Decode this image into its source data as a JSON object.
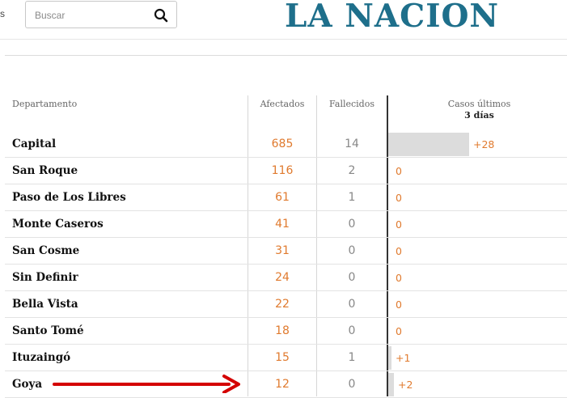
{
  "header": {
    "left_fragment": "s",
    "search": {
      "placeholder": "Buscar"
    },
    "logo": "LA NACION"
  },
  "table": {
    "headers": {
      "department": "Departamento",
      "affected": "Afectados",
      "deceased": "Fallecidos",
      "recent_cases_line1": "Casos últimos",
      "recent_cases_line2": "3 días"
    },
    "rows": [
      {
        "name": "Capital",
        "affected": "685",
        "deceased": "14",
        "recent": "+28",
        "recent_value": 28
      },
      {
        "name": "San Roque",
        "affected": "116",
        "deceased": "2",
        "recent": "0",
        "recent_value": 0
      },
      {
        "name": "Paso de Los Libres",
        "affected": "61",
        "deceased": "1",
        "recent": "0",
        "recent_value": 0
      },
      {
        "name": "Monte Caseros",
        "affected": "41",
        "deceased": "0",
        "recent": "0",
        "recent_value": 0
      },
      {
        "name": "San Cosme",
        "affected": "31",
        "deceased": "0",
        "recent": "0",
        "recent_value": 0
      },
      {
        "name": "Sin Definir",
        "affected": "24",
        "deceased": "0",
        "recent": "0",
        "recent_value": 0
      },
      {
        "name": "Bella Vista",
        "affected": "22",
        "deceased": "0",
        "recent": "0",
        "recent_value": 0
      },
      {
        "name": "Santo Tomé",
        "affected": "18",
        "deceased": "0",
        "recent": "0",
        "recent_value": 0
      },
      {
        "name": "Ituzaingó",
        "affected": "15",
        "deceased": "1",
        "recent": "+1",
        "recent_value": 1
      },
      {
        "name": "Goya",
        "affected": "12",
        "deceased": "0",
        "recent": "+2",
        "recent_value": 2
      }
    ]
  },
  "colors": {
    "logo": "#1e6f8b",
    "affected": "#e07a2e",
    "bar": "#dcdcdc",
    "arrow": "#d40000"
  },
  "annotation": {
    "arrow_target": "Goya"
  }
}
